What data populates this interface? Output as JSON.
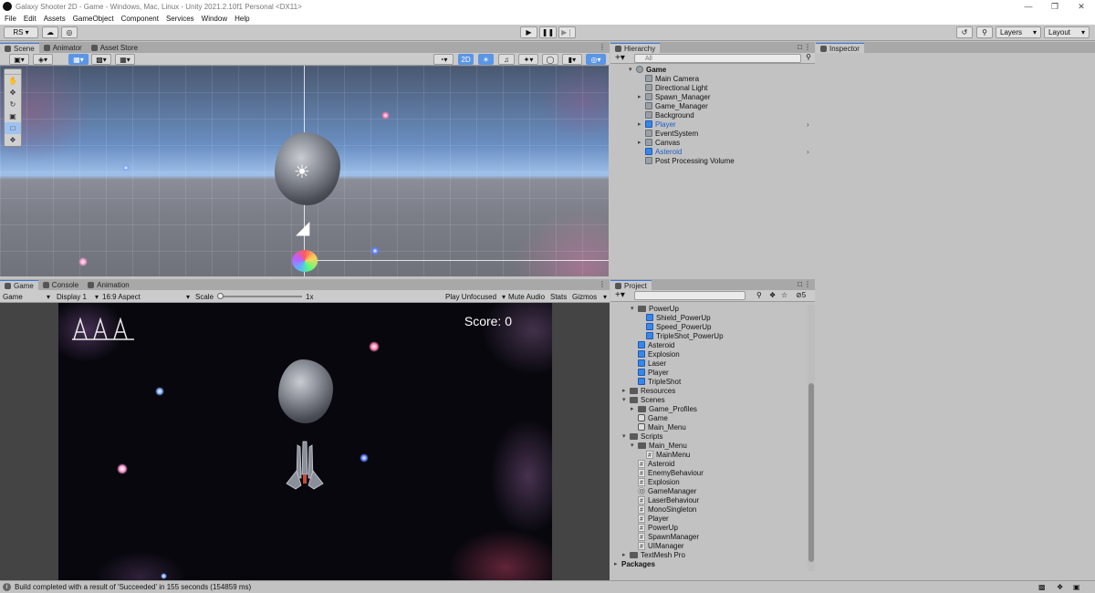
{
  "window": {
    "title": "Galaxy Shooter 2D - Game - Windows, Mac, Linux - Unity 2021.2.10f1 Personal <DX11>",
    "min_icon": "minimize-icon",
    "max_icon": "restore-icon",
    "close_icon": "close-icon"
  },
  "menu": [
    "File",
    "Edit",
    "Assets",
    "GameObject",
    "Component",
    "Services",
    "Window",
    "Help"
  ],
  "toolbar": {
    "account": "RS",
    "play_icon": "play-icon",
    "pause_icon": "pause-icon",
    "step_icon": "step-icon",
    "layers": "Layers",
    "layout": "Layout"
  },
  "scene_panel": {
    "tabs": [
      "Scene",
      "Animator",
      "Asset Store"
    ],
    "mode_2d": "2D"
  },
  "game_panel": {
    "tabs": [
      "Game",
      "Console",
      "Animation"
    ],
    "display_mode": "Game",
    "display": "Display 1",
    "aspect": "16:9 Aspect",
    "scale_label": "Scale",
    "scale_value": "1x",
    "play_mode": "Play Unfocused",
    "mute": "Mute Audio",
    "stats": "Stats",
    "gizmos": "Gizmos",
    "score_text": "Score: 0"
  },
  "hierarchy": {
    "tab": "Hierarchy",
    "search_placeholder": "All",
    "scene_name": "Game",
    "items": [
      {
        "label": "Main Camera",
        "prefab": false,
        "expandable": false
      },
      {
        "label": "Directional Light",
        "prefab": false,
        "expandable": false
      },
      {
        "label": "Spawn_Manager",
        "prefab": false,
        "expandable": true
      },
      {
        "label": "Game_Manager",
        "prefab": false,
        "expandable": false
      },
      {
        "label": "Background",
        "prefab": false,
        "expandable": false
      },
      {
        "label": "Player",
        "prefab": true,
        "expandable": true
      },
      {
        "label": "EventSystem",
        "prefab": false,
        "expandable": false
      },
      {
        "label": "Canvas",
        "prefab": false,
        "expandable": true
      },
      {
        "label": "Asteroid",
        "prefab": true,
        "expandable": false
      },
      {
        "label": "Post Processing Volume",
        "prefab": false,
        "expandable": false
      }
    ]
  },
  "inspector": {
    "tab": "Inspector"
  },
  "project": {
    "tab": "Project",
    "hidden_count": "5",
    "tree": [
      {
        "label": "PowerUp",
        "type": "folder",
        "depth": 2,
        "arrow": "open"
      },
      {
        "label": "Shield_PowerUp",
        "type": "prefab",
        "depth": 3
      },
      {
        "label": "Speed_PowerUp",
        "type": "prefab",
        "depth": 3
      },
      {
        "label": "TripleShot_PowerUp",
        "type": "prefab",
        "depth": 3
      },
      {
        "label": "Asteroid",
        "type": "prefab",
        "depth": 2
      },
      {
        "label": "Explosion",
        "type": "prefab",
        "depth": 2
      },
      {
        "label": "Laser",
        "type": "prefab",
        "depth": 2
      },
      {
        "label": "Player",
        "type": "prefab",
        "depth": 2
      },
      {
        "label": "TripleShot",
        "type": "prefab",
        "depth": 2
      },
      {
        "label": "Resources",
        "type": "folder",
        "depth": 1,
        "arrow": "closed"
      },
      {
        "label": "Scenes",
        "type": "folder",
        "depth": 1,
        "arrow": "open"
      },
      {
        "label": "Game_Profiles",
        "type": "folder",
        "depth": 2,
        "arrow": "closed"
      },
      {
        "label": "Game",
        "type": "scene",
        "depth": 2
      },
      {
        "label": "Main_Menu",
        "type": "scene",
        "depth": 2
      },
      {
        "label": "Scripts",
        "type": "folder",
        "depth": 1,
        "arrow": "open"
      },
      {
        "label": "Main_Menu",
        "type": "folder",
        "depth": 2,
        "arrow": "open"
      },
      {
        "label": "MainMenu",
        "type": "script",
        "depth": 3
      },
      {
        "label": "Asteroid",
        "type": "script",
        "depth": 2
      },
      {
        "label": "EnemyBehaviour",
        "type": "script",
        "depth": 2
      },
      {
        "label": "Explosion",
        "type": "script",
        "depth": 2
      },
      {
        "label": "GameManager",
        "type": "gear",
        "depth": 2
      },
      {
        "label": "LaserBehaviour",
        "type": "script",
        "depth": 2
      },
      {
        "label": "MonoSingleton",
        "type": "script",
        "depth": 2
      },
      {
        "label": "Player",
        "type": "script",
        "depth": 2
      },
      {
        "label": "PowerUp",
        "type": "script",
        "depth": 2
      },
      {
        "label": "SpawnManager",
        "type": "script",
        "depth": 2
      },
      {
        "label": "UIManager",
        "type": "script",
        "depth": 2
      },
      {
        "label": "TextMesh Pro",
        "type": "folder",
        "depth": 1,
        "arrow": "closed"
      },
      {
        "label": "Packages",
        "type": "root",
        "depth": 0,
        "arrow": "closed"
      }
    ]
  },
  "status": {
    "message": "Build completed with a result of 'Succeeded' in 155 seconds (154859 ms)"
  }
}
